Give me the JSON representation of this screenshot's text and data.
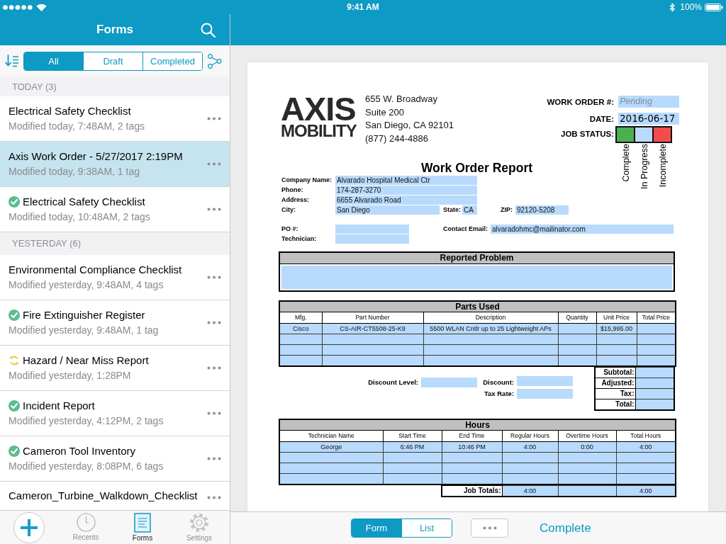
{
  "status_bar": {
    "time": "9:41 AM",
    "battery": "100%"
  },
  "sidebar": {
    "title": "Forms",
    "filters": [
      {
        "label": "All",
        "selected": true
      },
      {
        "label": "Draft",
        "selected": false
      },
      {
        "label": "Completed",
        "selected": false
      }
    ],
    "sections": [
      {
        "heading": "TODAY (3)",
        "items": [
          {
            "title": "Electrical Safety Checklist",
            "subtitle": "Modified today, 7:48AM, 2 tags",
            "completed": false,
            "syncing": false,
            "selected": false
          },
          {
            "title": "Axis Work Order - 5/27/2017 2:19PM",
            "subtitle": "Modified today, 9:38AM, 1 tag",
            "completed": false,
            "syncing": false,
            "selected": true
          },
          {
            "title": "Electrical Safety Checklist",
            "subtitle": "Modified today, 10:48AM, 2 tags",
            "completed": true,
            "syncing": false,
            "selected": false
          }
        ]
      },
      {
        "heading": "YESTERDAY (6)",
        "items": [
          {
            "title": "Environmental Compliance Checklist",
            "subtitle": "Modified yesterday, 9:48AM, 4 tags",
            "completed": false,
            "syncing": false,
            "selected": false
          },
          {
            "title": "Fire Extinguisher Register",
            "subtitle": "Modified yesterday, 9:48AM, 1 tag",
            "completed": true,
            "syncing": false,
            "selected": false
          },
          {
            "title": "Hazard / Near Miss Report",
            "subtitle": "Modified yesterday, 1:28PM",
            "completed": false,
            "syncing": true,
            "selected": false
          },
          {
            "title": "Incident Report",
            "subtitle": "Modified yesterday, 4:12PM, 2 tags",
            "completed": true,
            "syncing": false,
            "selected": false
          },
          {
            "title": "Cameron Tool Inventory",
            "subtitle": "Modified yesterday, 8:08PM, 6 tags",
            "completed": true,
            "syncing": false,
            "selected": false
          },
          {
            "title": "Cameron_Turbine_Walkdown_Checklist",
            "completed": false,
            "syncing": false,
            "selected": false
          }
        ]
      }
    ]
  },
  "tab_bar": {
    "items": [
      {
        "label": "Recents",
        "kind": "recents",
        "selected": false
      },
      {
        "label": "Forms",
        "kind": "forms",
        "selected": true
      },
      {
        "label": "Settings",
        "kind": "settings",
        "selected": false
      }
    ]
  },
  "document": {
    "logo": {
      "top": "AXIS",
      "bottom": "MOBILITY"
    },
    "address": [
      "655 W. Broadway",
      "Suite 200",
      "San Diego, CA 92101",
      "(877) 244-4886"
    ],
    "work_order": {
      "label": "WORK ORDER #:",
      "placeholder": "Pending"
    },
    "date": {
      "label": "DATE:",
      "value": "2016-06-17"
    },
    "job_status": {
      "label": "JOB STATUS:",
      "options": [
        {
          "label": "Complete",
          "color": "#4caf50"
        },
        {
          "label": "In Progress",
          "color": "#b8dafc"
        },
        {
          "label": "Incomplete",
          "color": "#f44c4c"
        }
      ]
    },
    "title": "Work Order Report",
    "customer": {
      "company": {
        "label": "Company Name:",
        "value": "Alvarado Hospital Medical Ctr"
      },
      "phone": {
        "label": "Phone:",
        "value": "174-287-3270"
      },
      "address": {
        "label": "Address:",
        "value": "6655 Alvarado Road"
      },
      "city": {
        "label": "City:",
        "value": "San Diego"
      },
      "state": {
        "label": "State:",
        "value": "CA"
      },
      "zip": {
        "label": "ZIP:",
        "value": "92120-5208"
      },
      "po": {
        "label": "PO #:"
      },
      "technician": {
        "label": "Technician:"
      },
      "contact_email": {
        "label": "Contact Email:",
        "value": "alvaradohmc@mailinator.com"
      }
    },
    "reported_problem": {
      "title": "Reported Problem"
    },
    "parts": {
      "title": "Parts Used",
      "columns": [
        "Mfg.",
        "Part Number",
        "Description",
        "Quantity",
        "Unit Price",
        "Total Price"
      ],
      "rows": [
        [
          "Cisco",
          "CS-AIR-CT5508-25-K9",
          "5500 WLAN Cntlr up to 25 Lightweight APs",
          null,
          "$15,995.00",
          null
        ],
        [
          null,
          null,
          null,
          null,
          null,
          null
        ],
        [
          null,
          null,
          null,
          null,
          null,
          null
        ],
        [
          null,
          null,
          null,
          null,
          null,
          null
        ]
      ],
      "discount": {
        "level": {
          "label": "Discount Level:"
        },
        "discount": {
          "label": "Discount:"
        },
        "tax_rate": {
          "label": "Tax Rate:"
        }
      },
      "totals": [
        {
          "label": "Subtotal:"
        },
        {
          "label": "Adjusted:"
        },
        {
          "label": "Tax:"
        },
        {
          "label": "Total:"
        }
      ]
    },
    "hours": {
      "title": "Hours",
      "columns": [
        "Technician Name",
        "Start Time",
        "End Time",
        "Regular Hours",
        "Overtime Hours",
        "Total Hours"
      ],
      "rows": [
        [
          "George",
          "6:46 PM",
          "10:46 PM",
          "4:00",
          "0:00",
          "4:00"
        ],
        [
          null,
          null,
          null,
          null,
          null,
          null
        ],
        [
          null,
          null,
          null,
          null,
          null,
          null
        ],
        [
          null,
          null,
          null,
          null,
          null,
          null
        ]
      ],
      "totals": {
        "label": "Job Totals:",
        "regular_hours": "4:00",
        "total_hours": "4:00"
      }
    }
  },
  "toolbar": {
    "views": [
      {
        "label": "Form",
        "selected": true
      },
      {
        "label": "List",
        "selected": false
      }
    ],
    "action": "Complete"
  }
}
